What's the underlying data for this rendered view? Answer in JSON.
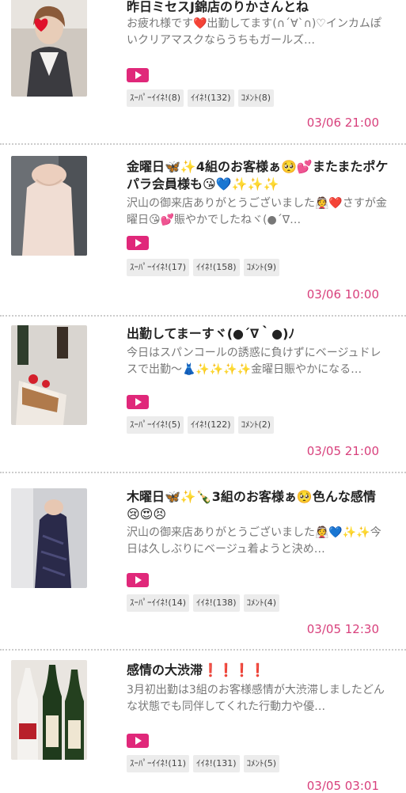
{
  "colors": {
    "accent": "#e0287a",
    "date": "#d8407c",
    "badge_bg": "#ececec"
  },
  "posts": [
    {
      "title": "昨日ミセスJ錦店のりかさんとね",
      "excerpt": "お疲れ様です❤️出勤してます(∩´∀`∩)♡インカムぽいクリアマスクならうちもガールズ…",
      "play_icon": "play-icon",
      "badges": [
        "ｽｰﾊﾟｰｲｲﾈ!(8)",
        "ｲｲﾈ!(132)",
        "ｺﾒﾝﾄ(8)"
      ],
      "date": "03/06 21:00"
    },
    {
      "title": "金曜日🦋✨4組のお客様ぁ🥺💕またまたポケパラ会員様も😘💙✨✨✨",
      "excerpt": "沢山の御来店ありがとうございました👰❤️さすが金曜日😘💕賑やかでしたねヾ(●´∇…",
      "play_icon": "play-icon",
      "badges": [
        "ｽｰﾊﾟｰｲｲﾈ!(17)",
        "ｲｲﾈ!(158)",
        "ｺﾒﾝﾄ(9)"
      ],
      "date": "03/06 10:00"
    },
    {
      "title": "出勤してまーすヾ(●´∇｀●)ﾉ",
      "excerpt": "今日はスパンコールの誘惑に負けずにベージュドレスで出勤〜👗✨✨✨✨金曜日賑やかになる…",
      "play_icon": "play-icon",
      "badges": [
        "ｽｰﾊﾟｰｲｲﾈ!(5)",
        "ｲｲﾈ!(122)",
        "ｺﾒﾝﾄ(2)"
      ],
      "date": "03/05 21:00"
    },
    {
      "title": "木曜日🦋✨🍾3組のお客様ぁ🥺色んな感情😢😍😣",
      "excerpt": "沢山の御来店ありがとうございました👰💙✨✨今日は久しぶりにベージュ着ようと決め…",
      "play_icon": "play-icon",
      "badges": [
        "ｽｰﾊﾟｰｲｲﾈ!(14)",
        "ｲｲﾈ!(138)",
        "ｺﾒﾝﾄ(4)"
      ],
      "date": "03/05 12:30"
    },
    {
      "title": "感情の大渋滞❗️❗️❗️❗️",
      "excerpt": "3月初出勤は3組のお客様感情が大渋滞しましたどんな状態でも同伴してくれた行動力や優…",
      "play_icon": "play-icon",
      "badges": [
        "ｽｰﾊﾟｰｲｲﾈ!(11)",
        "ｲｲﾈ!(131)",
        "ｺﾒﾝﾄ(5)"
      ],
      "date": "03/05 03:01"
    }
  ]
}
